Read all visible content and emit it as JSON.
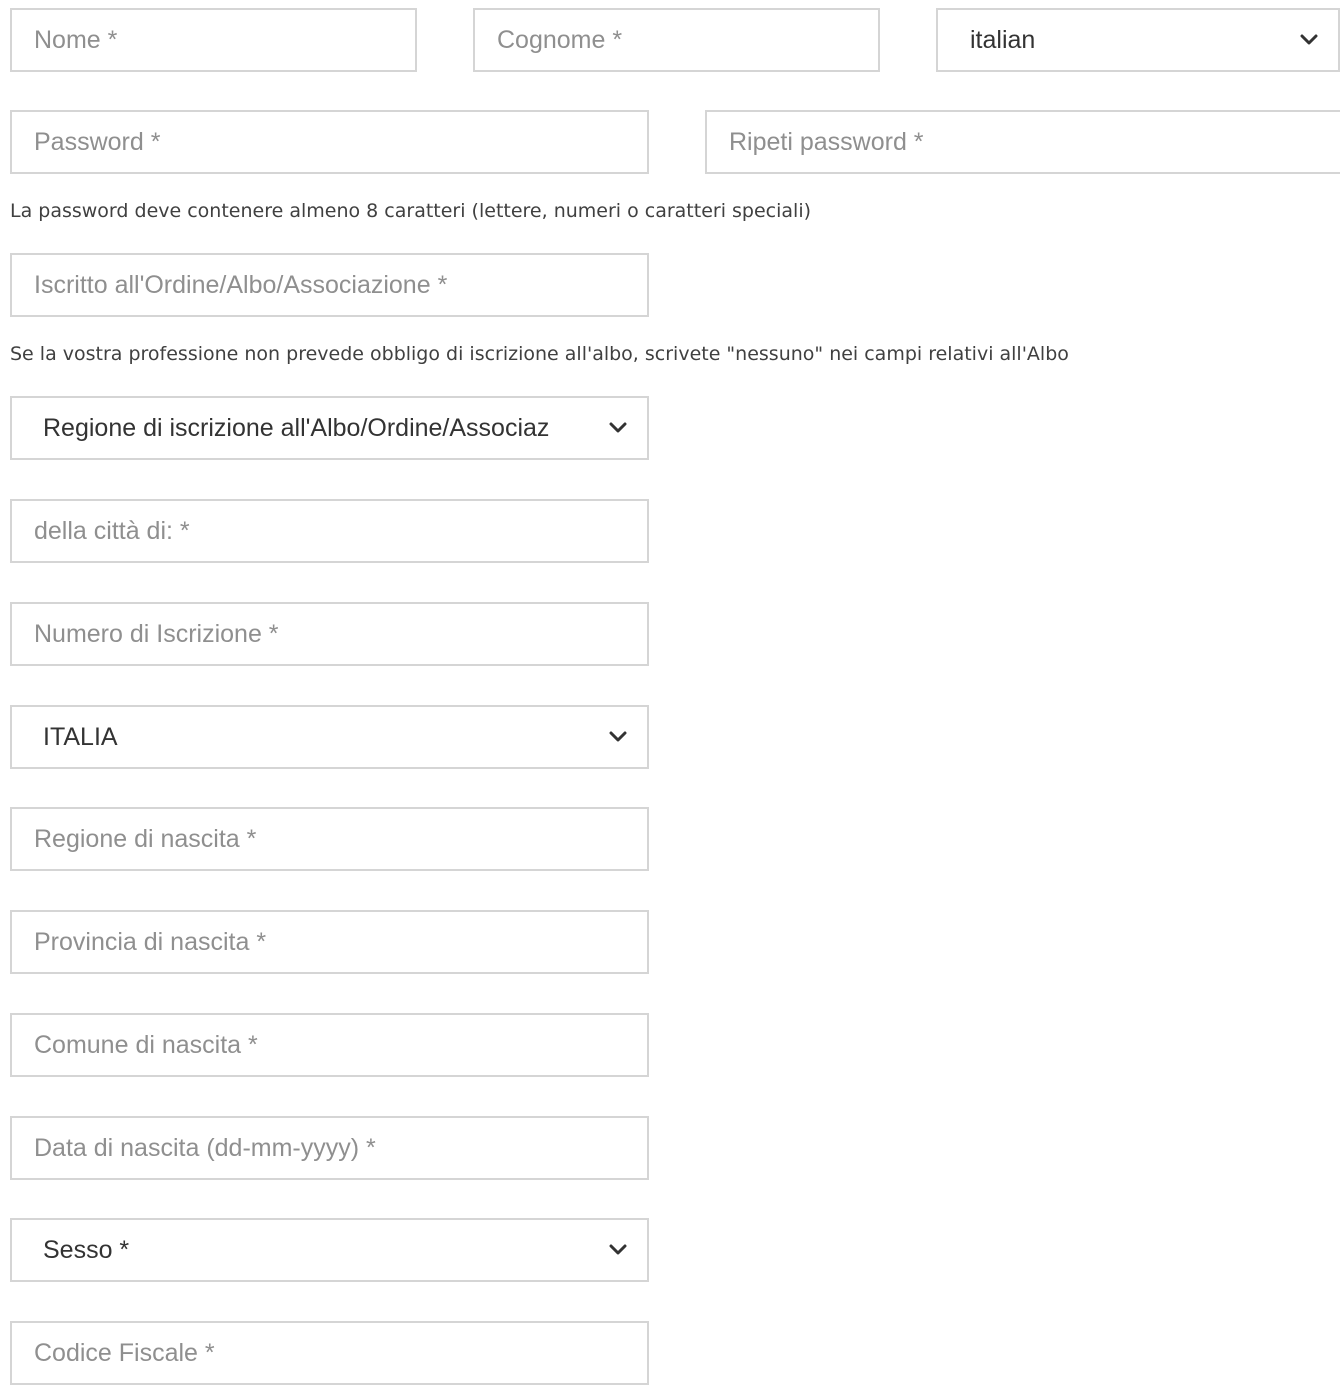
{
  "form": {
    "nome": {
      "placeholder": "Nome *"
    },
    "cognome": {
      "placeholder": "Cognome *"
    },
    "language": {
      "value": "italian",
      "icon": "chevron-down-icon"
    },
    "password": {
      "placeholder": "Password *"
    },
    "password_repeat": {
      "placeholder": "Ripeti password *"
    },
    "password_hint": "La password deve contenere almeno 8 caratteri (lettere, numeri o caratteri speciali)",
    "iscritto": {
      "placeholder": "Iscritto all'Ordine/Albo/Associazione *"
    },
    "albo_hint": "Se la vostra professione non prevede obbligo di iscrizione all'albo, scrivete \"nessuno\" nei campi relativi all'Albo",
    "regione_iscrizione": {
      "value": "Regione di iscrizione all'Albo/Ordine/Associaz",
      "icon": "chevron-down-icon"
    },
    "citta": {
      "placeholder": "della città di: *"
    },
    "numero_iscrizione": {
      "placeholder": "Numero di Iscrizione *"
    },
    "paese": {
      "value": "ITALIA",
      "icon": "chevron-down-icon"
    },
    "regione_nascita": {
      "placeholder": "Regione di nascita *"
    },
    "provincia_nascita": {
      "placeholder": "Provincia di nascita *"
    },
    "comune_nascita": {
      "placeholder": "Comune di nascita *"
    },
    "data_nascita": {
      "placeholder": "Data di nascita (dd-mm-yyyy) *"
    },
    "sesso": {
      "value": "Sesso *",
      "icon": "chevron-down-icon"
    },
    "codice_fiscale": {
      "placeholder": "Codice Fiscale *"
    }
  },
  "colors": {
    "border": "#d5d5d5",
    "placeholder": "#8f8f8f",
    "text": "#333333",
    "hint_text": "#404040"
  }
}
